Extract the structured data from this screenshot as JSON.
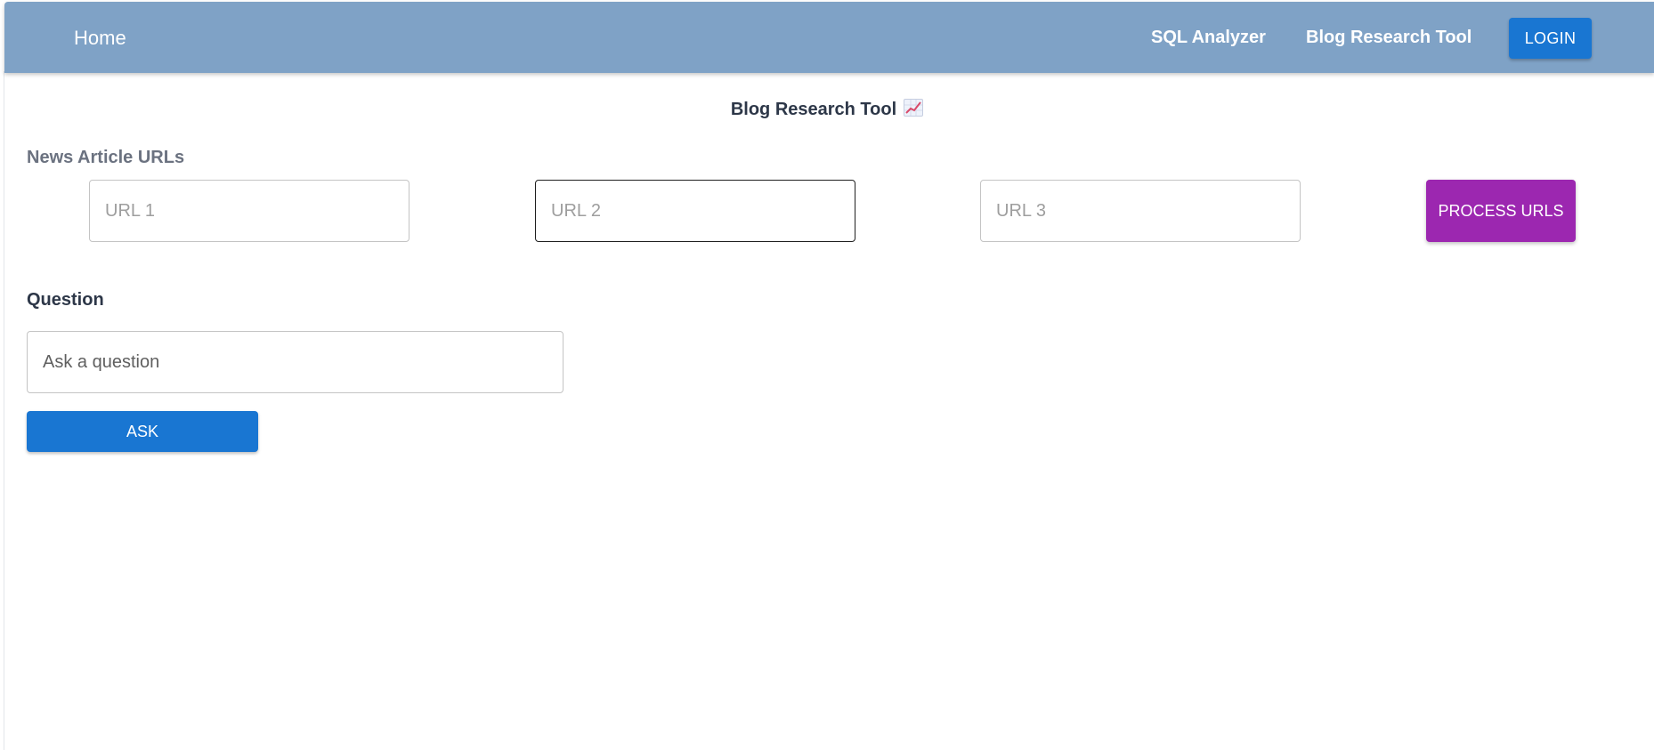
{
  "navbar": {
    "home_label": "Home",
    "links": [
      {
        "label": "SQL Analyzer"
      },
      {
        "label": "Blog Research Tool"
      }
    ],
    "login_label": "LOGIN",
    "background_color": "#7fa2c6",
    "login_color": "#1976d2"
  },
  "main": {
    "title": "Blog Research Tool",
    "title_icon": "chart-increasing-icon",
    "urls_section_label": "News Article URLs",
    "url_inputs": [
      {
        "placeholder": "URL 1",
        "value": ""
      },
      {
        "placeholder": "URL 2",
        "value": ""
      },
      {
        "placeholder": "URL 3",
        "value": ""
      }
    ],
    "process_button_label": "PROCESS URLS",
    "process_button_color": "#9c27b0",
    "question_section_label": "Question",
    "question_input": {
      "placeholder": "Ask a question",
      "value": ""
    },
    "ask_button_label": "ASK",
    "ask_button_color": "#1976d2"
  }
}
